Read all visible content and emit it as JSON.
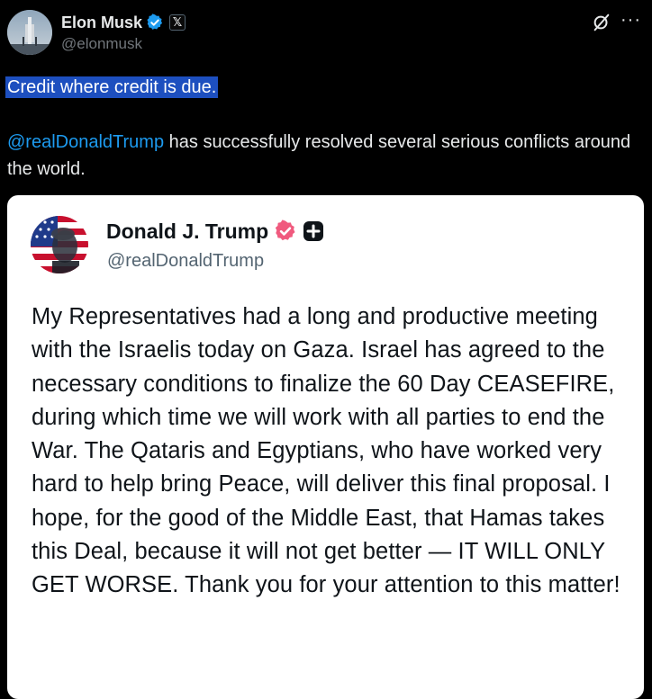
{
  "author": {
    "name": "Elon Musk",
    "handle": "@elonmusk",
    "affiliation_badge": "𝕏",
    "verified_icon": "blue-check-icon"
  },
  "post": {
    "first_line": "Credit where credit is due.",
    "mention": "@realDonaldTrump",
    "body_rest": " has successfully resolved several serious conflicts around the world."
  },
  "quoted": {
    "name": "Donald J. Trump",
    "handle": "@realDonaldTrump",
    "verified_icon": "pink-check-icon",
    "plus_icon": "plus-badge-icon",
    "text": "My Representatives had a long and productive meeting with the Israelis today on Gaza. Israel has agreed to the necessary conditions to finalize the 60 Day CEASEFIRE, during which time we will work with all parties to end the War. The Qataris and Egyptians, who have worked very hard to help bring Peace, will deliver this final proposal. I hope, for the good of the Middle East, that Hamas takes this Deal, because it will not get better — IT WILL ONLY GET WORSE. Thank you for your attention to this matter!"
  },
  "actions": {
    "grok_icon": "grok-icon",
    "more_label": "···"
  },
  "colors": {
    "background": "#000000",
    "text": "#e7e9ea",
    "secondary": "#71767b",
    "link": "#1d9bf0",
    "selection": "#1d4fbf",
    "verified_blue": "#1d9bf0",
    "verified_pink": "#f05a7e"
  }
}
